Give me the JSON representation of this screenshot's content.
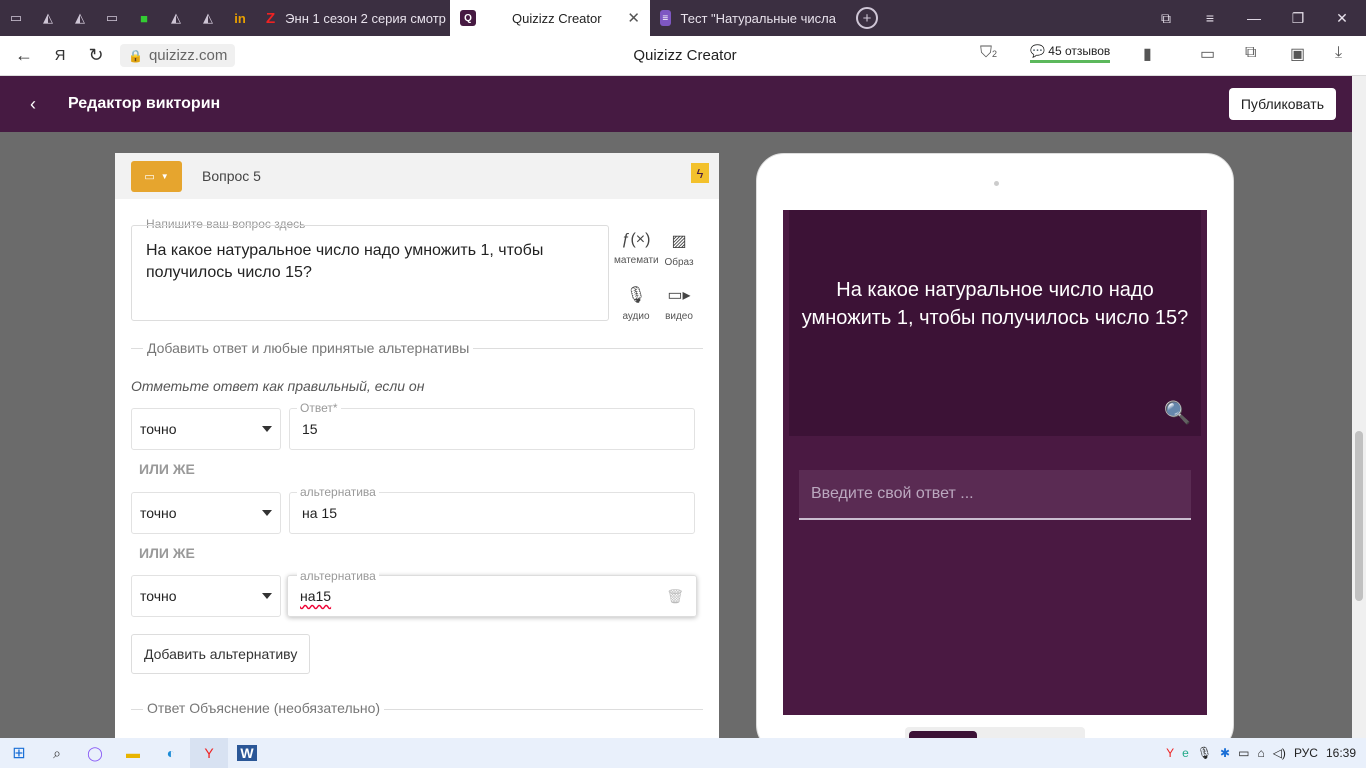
{
  "browser": {
    "tabs": [
      {
        "label": "Энн 1 сезон 2 серия смотр",
        "icon": "z-icon"
      },
      {
        "label": "Quizizz Creator",
        "icon": "quizizz-icon",
        "active": true
      },
      {
        "label": "Тест \"Натуральные числа",
        "icon": "form-icon"
      }
    ],
    "url": "quizizz.com",
    "page_title": "Quizizz Creator",
    "reviews": "45 отзывов",
    "protect_badge": "2"
  },
  "header": {
    "title": "Редактор викторин",
    "publish_label": "Публиковать"
  },
  "editor": {
    "question_number": "Вопрос 5",
    "question_label": "Напишите ваш вопрос здесь",
    "question_text": "На какое натуральное число надо умножить 1, чтобы получилось число 15?",
    "tools": [
      {
        "label": "математи",
        "icon": "function-icon"
      },
      {
        "label": "Образ",
        "icon": "image-icon"
      },
      {
        "label": "аудио",
        "icon": "microphone-icon"
      },
      {
        "label": "видео",
        "icon": "video-icon"
      }
    ],
    "answers_section": "Добавить ответ и любые принятые альтернативы",
    "hint": "Отметьте ответ как правильный, если он",
    "or_label": "ИЛИ ЖЕ",
    "answers": [
      {
        "match": "точно",
        "label": "Ответ*",
        "value": "15"
      },
      {
        "match": "точно",
        "label": "альтернатива",
        "value": "на 15"
      },
      {
        "match": "точно",
        "label": "альтернатива",
        "value": "на15"
      }
    ],
    "add_alt_label": "Добавить альтернативу",
    "explanation_section": "Ответ Объяснение (необязательно)"
  },
  "preview": {
    "question_text": "На какое натуральное число надо умножить 1, чтобы получилось число 15?",
    "input_placeholder": "Введите свой ответ ..."
  },
  "taskbar": {
    "lang": "РУС",
    "time": "16:39"
  }
}
